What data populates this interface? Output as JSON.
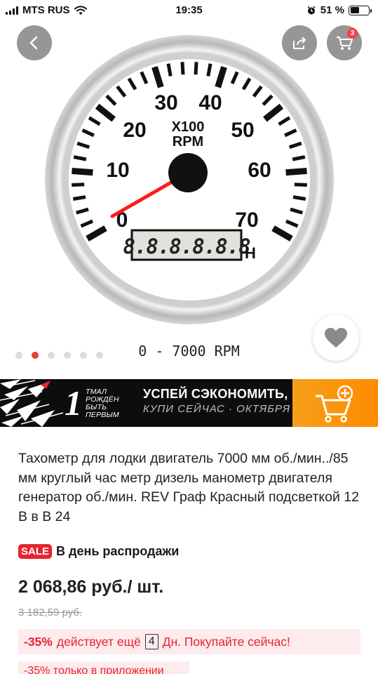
{
  "status_bar": {
    "carrier": "MTS RUS",
    "time": "19:35",
    "battery_percent": "51 %",
    "battery_level": 0.51
  },
  "nav": {
    "cart_count": "3"
  },
  "gauge": {
    "numbers": [
      "0",
      "10",
      "20",
      "30",
      "40",
      "50",
      "60",
      "70"
    ],
    "unit_line1": "X100",
    "unit_line2": "RPM",
    "odometer": "8.8.8.8.8.8",
    "hour_unit": "H"
  },
  "gallery": {
    "caption": "0 - 7000 RPM",
    "active_index": 1,
    "total": 6
  },
  "banner": {
    "number": "1",
    "tagline": [
      "ТМАЛ",
      "РОЖДЁН",
      "БЫТЬ",
      "ПЕРВЫМ"
    ],
    "headline": "УСПЕЙ СЭКОНОМИТЬ,",
    "subline": "КУПИ СЕЙЧАС · ОКТЯБРЯ"
  },
  "product": {
    "title": "Тахометр для лодки двигатель 7000 мм об./мин../85 мм круглый час метр дизель манометр двигателя генератор об./мин. REV Граф Красный подсветкой 12 В в В 24",
    "sale_badge": "SALE",
    "sale_text": "В день распродажи",
    "price": "2 068,86 руб./ шт.",
    "old_price": "3 182,59 руб.",
    "discount_pct": "-35%",
    "discount_prefix": "действует ещё",
    "days_left": "4",
    "discount_suffix": "Дн. Покупайте сейчас!",
    "app_discount": "-35% только в приложении"
  },
  "colors": {
    "accent_red": "#e8242e",
    "banner_orange": "#ff8b00",
    "needle": "#ff1a1a"
  }
}
